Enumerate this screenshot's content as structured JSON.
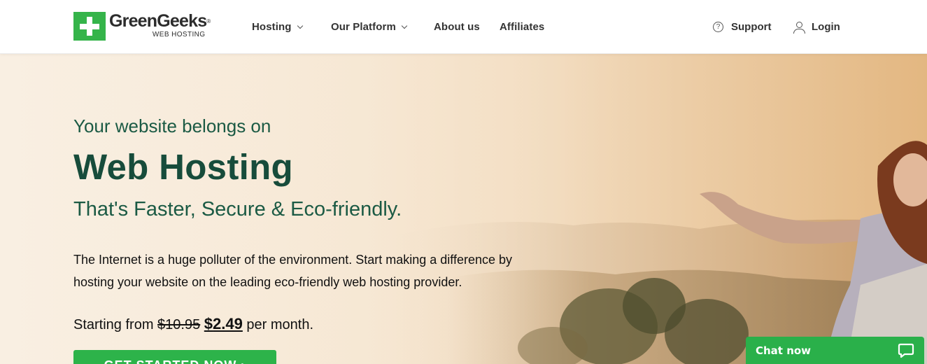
{
  "header": {
    "logo": {
      "name": "GreenGeeks",
      "registered": "®",
      "tagline": "WEB HOSTING"
    },
    "nav": [
      {
        "label": "Hosting",
        "has_dropdown": true
      },
      {
        "label": "Our Platform",
        "has_dropdown": true
      },
      {
        "label": "About us",
        "has_dropdown": false
      },
      {
        "label": "Affiliates",
        "has_dropdown": false
      }
    ],
    "support": {
      "label": "Support",
      "icon": "help-circle-icon"
    },
    "login": {
      "label": "Login",
      "icon": "user-icon"
    }
  },
  "hero": {
    "eyebrow": "Your website belongs on",
    "headline": "Web Hosting",
    "subhead": "That's Faster, Secure & Eco-friendly.",
    "description": "The Internet is a huge polluter of the environment. Start making a difference by hosting your website on the leading eco-friendly web hosting provider.",
    "price": {
      "prefix": "Starting from",
      "old_price": "$10.95",
      "currency": "$",
      "new_price": "2.49",
      "suffix": "per month."
    },
    "cta_label": "GET STARTED NOW ›"
  },
  "chat": {
    "label": "Chat now",
    "icon": "chat-bubble-icon"
  },
  "colors": {
    "brand_green": "#35b44a",
    "cta_green": "#2db34a",
    "heading_green": "#174c3b",
    "hero_warm": "#f2dcc0"
  }
}
